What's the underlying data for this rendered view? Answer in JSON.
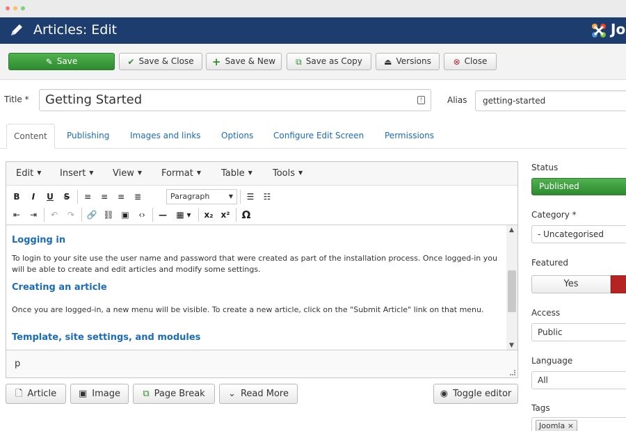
{
  "header": {
    "title": "Articles: Edit",
    "logo_text": "Jo"
  },
  "toolbar": {
    "save": "Save",
    "save_close": "Save & Close",
    "save_new": "Save & New",
    "save_copy": "Save as Copy",
    "versions": "Versions",
    "close": "Close"
  },
  "form": {
    "title_label": "Title *",
    "title_value": "Getting Started",
    "alias_label": "Alias",
    "alias_value": "getting-started"
  },
  "tabs": [
    "Content",
    "Publishing",
    "Images and links",
    "Options",
    "Configure Edit Screen",
    "Permissions"
  ],
  "editor": {
    "menus": [
      "Edit",
      "Insert",
      "View",
      "Format",
      "Table",
      "Tools"
    ],
    "format_select": "Paragraph",
    "path": "p",
    "content": {
      "h1": "Logging in",
      "p1": "To login to your site use the user name and password that were created as part of the installation process. Once logged-in you will be able to create and edit articles and modify some settings.",
      "h2": "Creating an article",
      "p2": "Once you are logged-in, a new menu will be visible. To create a new article, click on the \"Submit Article\" link on that menu.",
      "h3": "Template, site settings, and modules"
    }
  },
  "bottom_buttons": {
    "article": "Article",
    "image": "Image",
    "page_break": "Page Break",
    "read_more": "Read More",
    "toggle_editor": "Toggle editor"
  },
  "sidebar": {
    "status_label": "Status",
    "status_value": "Published",
    "category_label": "Category *",
    "category_value": "- Uncategorised",
    "featured_label": "Featured",
    "featured_yes": "Yes",
    "access_label": "Access",
    "access_value": "Public",
    "language_label": "Language",
    "language_value": "All",
    "tags_label": "Tags",
    "tag_value": "Joomla ×"
  },
  "colors": {
    "header": "#1d3d6e",
    "save": "#3c9a3c",
    "link": "#1a6bb8",
    "featured_no": "#b52423"
  }
}
